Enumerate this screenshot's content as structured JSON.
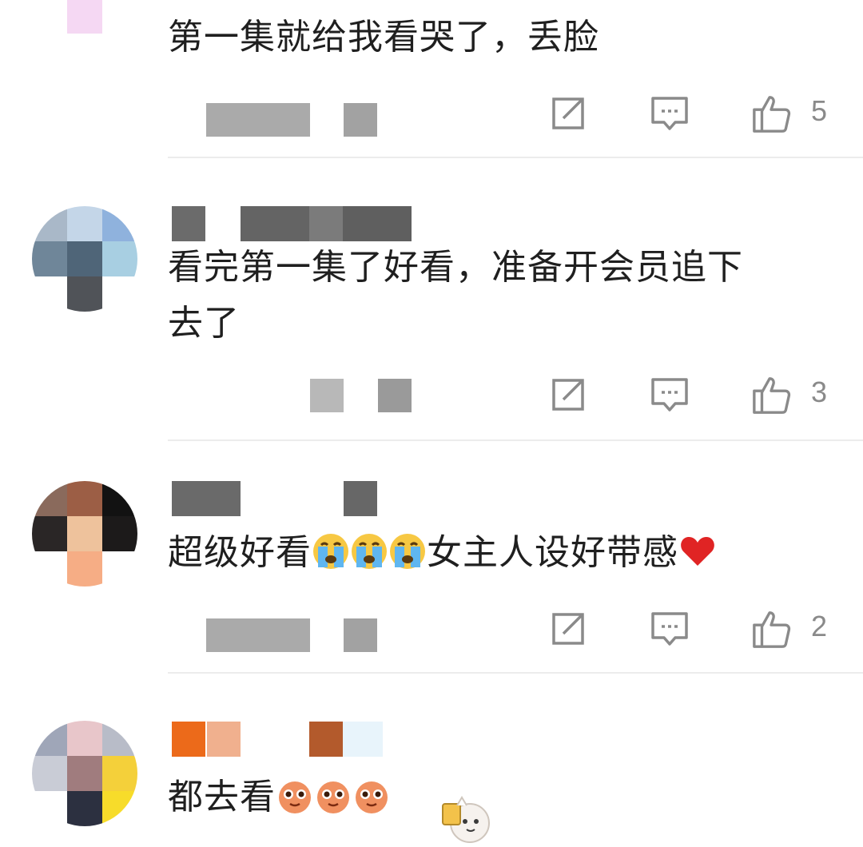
{
  "comments": [
    {
      "text": "第一集就给我看哭了，丢脸",
      "likes": "5"
    },
    {
      "text_line1": "看完第一集了好看，准备开会员追下",
      "text_line2": "去了",
      "likes": "3"
    },
    {
      "text_prefix": "超级好看",
      "text_suffix": "女主人设好带感",
      "emoji_inline": "crying-face-emoji",
      "emoji_end": "red-heart-emoji",
      "likes": "2"
    },
    {
      "text": "都去看",
      "emoji_inline": "pleading-face-emoji"
    }
  ],
  "icons": {
    "share": "share-icon",
    "reply": "reply-icon",
    "like": "thumbs-up-icon"
  },
  "colors": {
    "text": "#1f1f1f",
    "icon": "#8a8a8a",
    "heart": "#e02424",
    "divider": "#ececec"
  }
}
